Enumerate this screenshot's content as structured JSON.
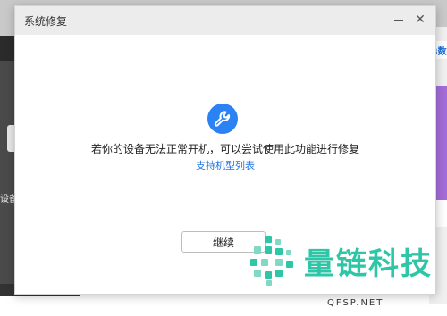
{
  "background_app": {
    "left_label": "设备",
    "right_label": "B数据"
  },
  "dialog": {
    "title": "系统修复",
    "minimize_glyph": "",
    "close_glyph": "✕",
    "icon": "wrench-icon",
    "message": "若你的设备无法正常开机，可以尝试使用此功能进行修复",
    "link_text": "支持机型列表",
    "continue_label": "继续"
  },
  "watermark": {
    "text": "量链科技",
    "subtext": "QFSP.NET"
  },
  "colors": {
    "accent": "#2b82f2",
    "link": "#1f74e3",
    "watermark": "#2fc6a8"
  }
}
